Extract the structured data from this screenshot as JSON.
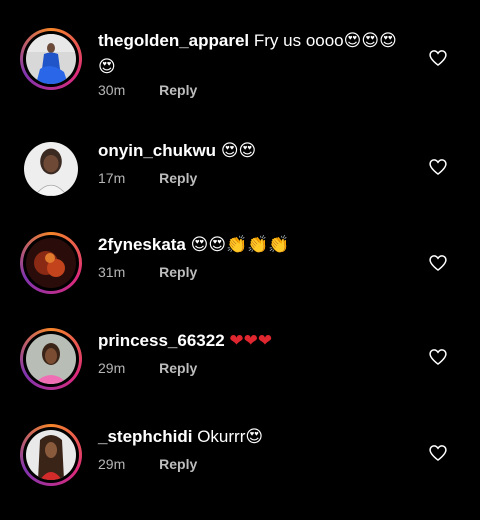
{
  "comments": [
    {
      "username": "thegolden_apparel",
      "text": "Fry us oooo",
      "emoji": "😍😍😍😍",
      "time": "30m",
      "reply": "Reply"
    },
    {
      "username": "onyin_chukwu",
      "text": "",
      "emoji": "😍😍",
      "time": "17m",
      "reply": "Reply"
    },
    {
      "username": "2fyneskata",
      "text": "",
      "emoji": "😍😍👏👏👏",
      "time": "31m",
      "reply": "Reply"
    },
    {
      "username": "princess_66322",
      "text": "",
      "emoji": "❤❤❤",
      "time": "29m",
      "reply": "Reply"
    },
    {
      "username": "_stephchidi",
      "text": "Okurrr",
      "emoji": "😍",
      "time": "29m",
      "reply": "Reply"
    }
  ],
  "icons": {
    "like": "heart-outline-icon"
  },
  "colors": {
    "background": "#000000",
    "text": "#ffffff",
    "muted": "#b5b5b5",
    "ring_start": "#f58529",
    "ring_mid": "#dd2a7b",
    "ring_end": "#8134af"
  }
}
